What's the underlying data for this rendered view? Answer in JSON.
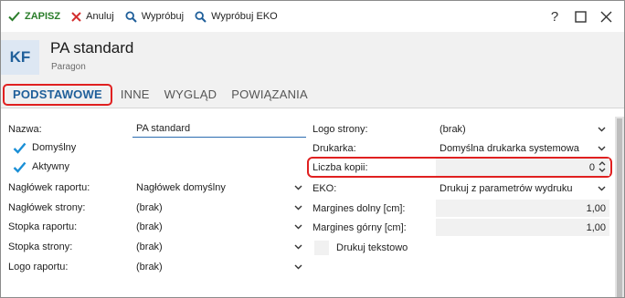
{
  "toolbar": {
    "save_label": "ZAPISZ",
    "cancel_label": "Anuluj",
    "test_label": "Wypróbuj",
    "test_eko_label": "Wypróbuj EKO",
    "help_label": "?"
  },
  "header": {
    "avatar": "KF",
    "title": "PA standard",
    "subtitle": "Paragon"
  },
  "tabs": [
    {
      "label": "PODSTAWOWE"
    },
    {
      "label": "INNE"
    },
    {
      "label": "WYGLĄD"
    },
    {
      "label": "POWIĄZANIA"
    }
  ],
  "left": {
    "name_label": "Nazwa:",
    "name_value": "PA standard",
    "default_label": "Domyślny",
    "active_label": "Aktywny",
    "report_header_label": "Nagłówek raportu:",
    "report_header_value": "Nagłówek domyślny",
    "page_header_label": "Nagłówek strony:",
    "page_header_value": "(brak)",
    "report_footer_label": "Stopka raportu:",
    "report_footer_value": "(brak)",
    "page_footer_label": "Stopka strony:",
    "page_footer_value": "(brak)",
    "report_logo_label": "Logo raportu:",
    "report_logo_value": "(brak)"
  },
  "right": {
    "page_logo_label": "Logo strony:",
    "page_logo_value": "(brak)",
    "printer_label": "Drukarka:",
    "printer_value": "Domyślna drukarka systemowa",
    "copies_label": "Liczba kopii:",
    "copies_value": "0",
    "eko_label": "EKO:",
    "eko_value": "Drukuj z parametrów wydruku",
    "margin_bottom_label": "Margines dolny [cm]:",
    "margin_bottom_value": "1,00",
    "margin_top_label": "Margines górny [cm]:",
    "margin_top_value": "1,00",
    "print_text_label": "Drukuj tekstowo"
  },
  "colors": {
    "accent": "#1f5f9a",
    "save_green": "#2a7d2a",
    "cancel_red": "#d32f2f",
    "highlight_red": "#e02020"
  }
}
